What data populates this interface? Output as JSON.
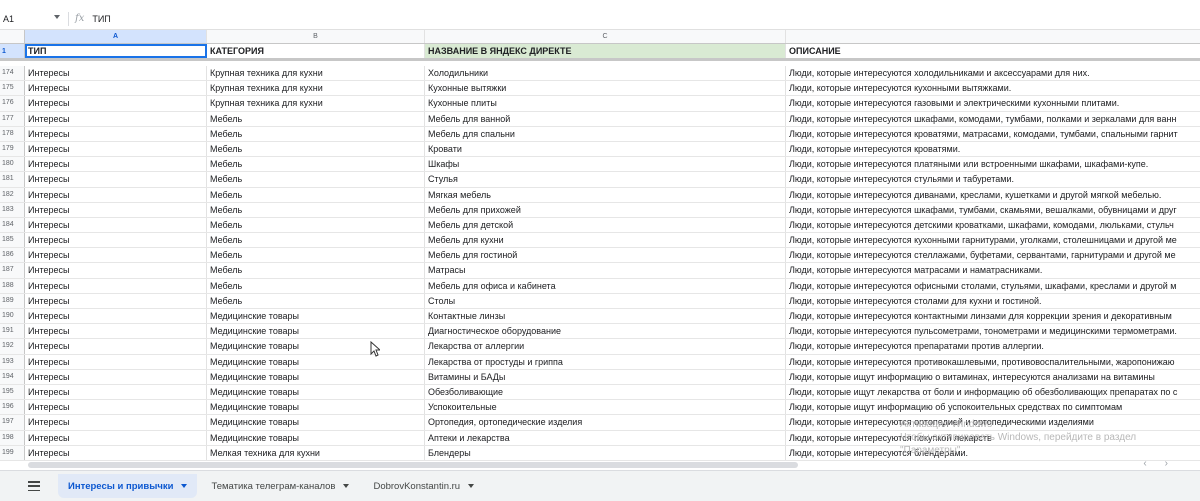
{
  "formula_bar": {
    "cell_ref": "A1",
    "fx_label": "fx",
    "value": "ТИП"
  },
  "columns": [
    "A",
    "B",
    "C",
    ""
  ],
  "header_row": {
    "row_num": "1",
    "cells": [
      "ТИП",
      "КАТЕГОРИЯ",
      "НАЗВАНИЕ В ЯНДЕКС ДИРЕКТЕ",
      "ОПИСАНИЕ"
    ]
  },
  "rows": [
    {
      "n": "174",
      "a": "Интересы",
      "b": "Крупная техника для кухни",
      "c": "Холодильники",
      "d": "Люди, которые интересуются холодильниками и аксессуарами для них."
    },
    {
      "n": "175",
      "a": "Интересы",
      "b": "Крупная техника для кухни",
      "c": "Кухонные вытяжки",
      "d": "Люди, которые интересуются кухонными вытяжками."
    },
    {
      "n": "176",
      "a": "Интересы",
      "b": "Крупная техника для кухни",
      "c": "Кухонные плиты",
      "d": "Люди, которые интересуются газовыми и электрическими кухонными плитами."
    },
    {
      "n": "177",
      "a": "Интересы",
      "b": "Мебель",
      "c": "Мебель для ванной",
      "d": "Люди, которые интересуются шкафами, комодами, тумбами, полками и зеркалами для ванн"
    },
    {
      "n": "178",
      "a": "Интересы",
      "b": "Мебель",
      "c": "Мебель для спальни",
      "d": "Люди, которые интересуются кроватями, матрасами, комодами, тумбами, спальными гарнит"
    },
    {
      "n": "179",
      "a": "Интересы",
      "b": "Мебель",
      "c": "Кровати",
      "d": "Люди, которые интересуются кроватями."
    },
    {
      "n": "180",
      "a": "Интересы",
      "b": "Мебель",
      "c": "Шкафы",
      "d": "Люди, которые интересуются платяными или встроенными шкафами, шкафами-купе."
    },
    {
      "n": "181",
      "a": "Интересы",
      "b": "Мебель",
      "c": "Стулья",
      "d": "Люди, которые интересуются стульями и табуретами."
    },
    {
      "n": "182",
      "a": "Интересы",
      "b": "Мебель",
      "c": "Мягкая мебель",
      "d": "Люди, которые интересуются диванами, креслами, кушетками и другой мягкой мебелью."
    },
    {
      "n": "183",
      "a": "Интересы",
      "b": "Мебель",
      "c": "Мебель для прихожей",
      "d": "Люди, которые интересуются шкафами, тумбами, скамьями, вешалками, обувницами и друг"
    },
    {
      "n": "184",
      "a": "Интересы",
      "b": "Мебель",
      "c": "Мебель для детской",
      "d": "Люди, которые интересуются детскими кроватками, шкафами, комодами, люльками, стульч"
    },
    {
      "n": "185",
      "a": "Интересы",
      "b": "Мебель",
      "c": "Мебель для кухни",
      "d": "Люди, которые интересуются кухонными гарнитурами, уголками, столешницами и другой ме"
    },
    {
      "n": "186",
      "a": "Интересы",
      "b": "Мебель",
      "c": "Мебель для гостиной",
      "d": "Люди, которые интересуются стеллажами, буфетами, сервантами, гарнитурами и другой ме"
    },
    {
      "n": "187",
      "a": "Интересы",
      "b": "Мебель",
      "c": "Матрасы",
      "d": "Люди, которые интересуются матрасами и наматрасниками."
    },
    {
      "n": "188",
      "a": "Интересы",
      "b": "Мебель",
      "c": "Мебель для офиса и кабинета",
      "d": "Люди, которые интересуются офисными столами, стульями, шкафами, креслами и другой м"
    },
    {
      "n": "189",
      "a": "Интересы",
      "b": "Мебель",
      "c": "Столы",
      "d": "Люди, которые интересуются столами для кухни и гостиной."
    },
    {
      "n": "190",
      "a": "Интересы",
      "b": "Медицинские товары",
      "c": "Контактные линзы",
      "d": "Люди, которые интересуются контактными линзами для коррекции зрения и декоративным"
    },
    {
      "n": "191",
      "a": "Интересы",
      "b": "Медицинские товары",
      "c": "Диагностическое оборудование",
      "d": "Люди, которые интересуются пульсометрами, тонометрами и медицинскими термометрами."
    },
    {
      "n": "192",
      "a": "Интересы",
      "b": "Медицинские товары",
      "c": "Лекарства от аллергии",
      "d": "Люди, которые интересуются препаратами против аллергии."
    },
    {
      "n": "193",
      "a": "Интересы",
      "b": "Медицинские товары",
      "c": "Лекарства от простуды и гриппа",
      "d": "Люди, которые интересуются противокашлевыми, противовоспалительными, жаропонижаю"
    },
    {
      "n": "194",
      "a": "Интересы",
      "b": "Медицинские товары",
      "c": "Витамины и БАДы",
      "d": "Люди, которые ищут информацию о витаминах, интересуются анализами на витамины"
    },
    {
      "n": "195",
      "a": "Интересы",
      "b": "Медицинские товары",
      "c": "Обезболивающие",
      "d": "Люди, которые ищут лекарства от боли и информацию об обезболивающих препаратах по с"
    },
    {
      "n": "196",
      "a": "Интересы",
      "b": "Медицинские товары",
      "c": "Успокоительные",
      "d": "Люди, которые ищут информацию об успокоительных средствах по симптомам"
    },
    {
      "n": "197",
      "a": "Интересы",
      "b": "Медицинские товары",
      "c": "Ортопедия, ортопедические изделия",
      "d": "Люди, которые интересуются ортопедией и ортопедическими изделиями"
    },
    {
      "n": "198",
      "a": "Интересы",
      "b": "Медицинские товары",
      "c": "Аптеки и лекарства",
      "d": "Люди, которые интересуются покупкой лекарств"
    },
    {
      "n": "199",
      "a": "Интересы",
      "b": "Мелкая техника для кухни",
      "c": "Блендеры",
      "d": "Люди, которые интересуются блендерами."
    }
  ],
  "watermark": [
    "Активация Windows",
    "Чтобы активировать Windows, перейдите в раздел",
    "\"Параметры\"."
  ],
  "sheet_tabs": [
    "Интересы и привычки",
    "Тематика телеграм-каналов",
    "DobrovKonstantin.ru"
  ],
  "colors": {
    "selection": "#1a73e8",
    "active_header": "#d3e3fd",
    "highlight_col_c": "#d9ead3"
  }
}
